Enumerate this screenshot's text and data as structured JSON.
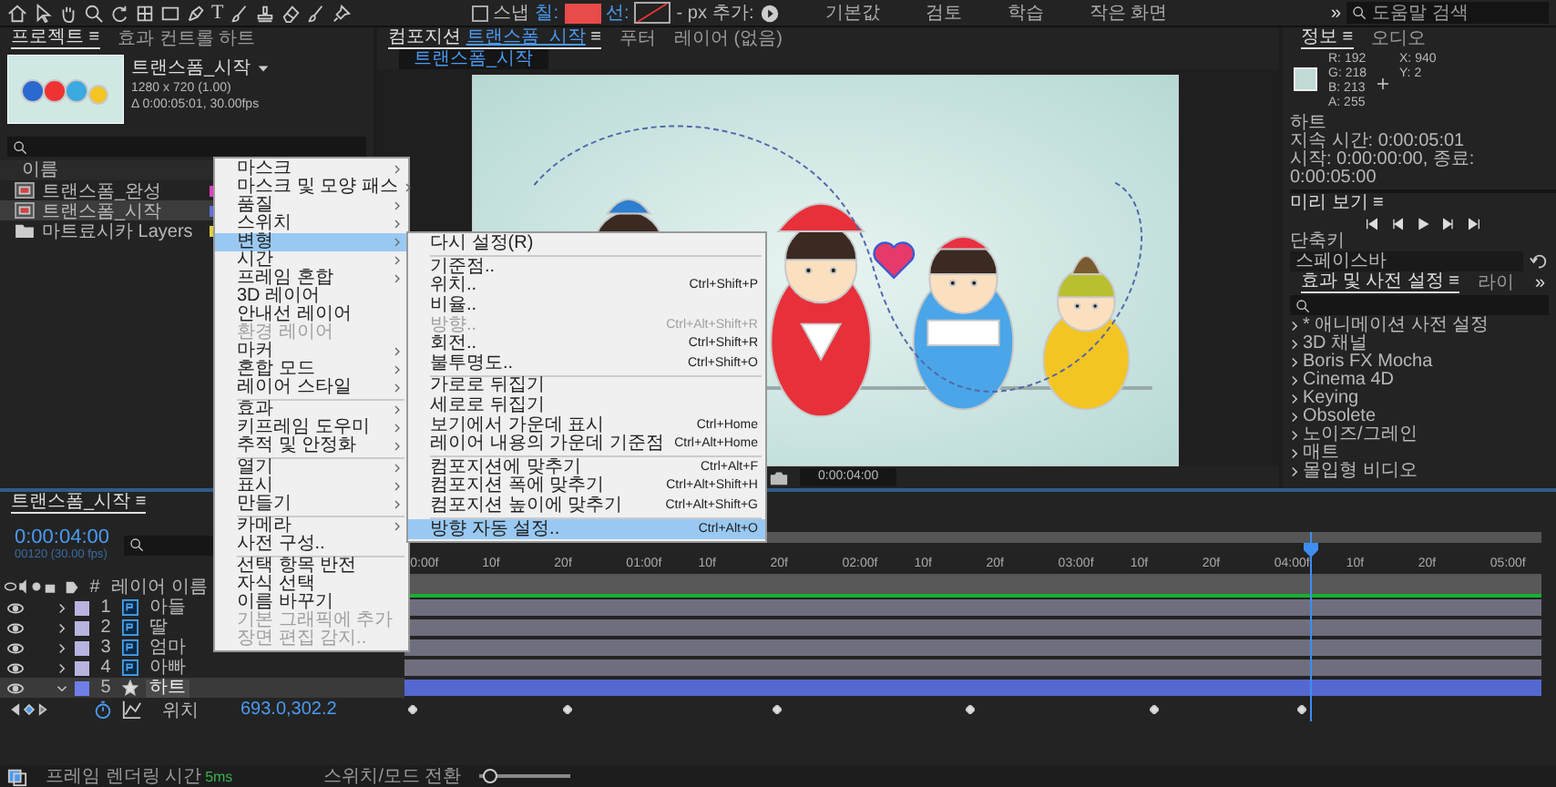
{
  "toolbar": {
    "type_tool": "T",
    "snap_checked": false,
    "snap": "스냅",
    "fill_label": "칠:",
    "stroke_label": "선:",
    "px": "- px",
    "add_label": "추가:",
    "workspaces": [
      "기본값",
      "검토",
      "학습",
      "작은 화면"
    ],
    "more": "»",
    "search_placeholder": "도움말 검색"
  },
  "project_panel": {
    "tabs": [
      {
        "label": "프로젝트",
        "menu": "≡",
        "selected": true
      },
      {
        "label": "효과 컨트롤 하트",
        "selected": false
      }
    ],
    "comp_name": "트랜스폼_시작",
    "comp_size": "1280 x 720 (1.00)",
    "comp_duration": "Δ 0:00:05:01, 30.00fps",
    "column": "이름",
    "items": [
      {
        "name": "트랜스폼_완성",
        "kind": "comp",
        "color": "#e040c0",
        "selected": false
      },
      {
        "name": "트랜스폼_시작",
        "kind": "comp",
        "color": "#6070e0",
        "selected": true
      },
      {
        "name": "마트료시카 Layers",
        "kind": "folder",
        "color": "#e0d040",
        "selected": false
      }
    ]
  },
  "composition_panel": {
    "tabs": [
      {
        "prefix": "컴포지션",
        "label": "트랜스폼_시작",
        "menu": "≡",
        "selected": true
      },
      {
        "label": "푸터",
        "selected": false
      },
      {
        "label": "레이어 (없음)",
        "selected": false
      }
    ],
    "comp_tab": "트랜스폼_시작",
    "current_time": "0:00:04:00"
  },
  "info_panel": {
    "tabs": [
      {
        "label": "정보",
        "menu": "≡",
        "selected": true
      },
      {
        "label": "오디오",
        "selected": false
      }
    ],
    "channels": [
      {
        "label": "R:",
        "value": "192"
      },
      {
        "label": "G:",
        "value": "218"
      },
      {
        "label": "B:",
        "value": "213"
      },
      {
        "label": "A:",
        "value": "255"
      }
    ],
    "coords": [
      {
        "label": "X:",
        "value": "940"
      },
      {
        "label": "Y:",
        "value": "2"
      }
    ],
    "lines": [
      "하트",
      "지속 시간: 0:00:05:01",
      "시작: 0:00:00:00, 종료: 0:00:05:00"
    ]
  },
  "preview_panel": {
    "title": "미리 보기",
    "menu": "≡",
    "shortcut_label": "단축키",
    "shortcut": "스페이스바"
  },
  "effects_panel": {
    "tabs": [
      {
        "label": "효과 및 사전 설정",
        "menu": "≡",
        "selected": true
      },
      {
        "label": "라이",
        "selected": false
      }
    ],
    "more": "»",
    "items": [
      "* 애니메이션 사전 설정",
      "3D 채널",
      "Boris FX Mocha",
      "Cinema 4D",
      "Keying",
      "Obsolete",
      "노이즈/그레인",
      "매트",
      "몰입형 비디오"
    ]
  },
  "timeline": {
    "tab": "트랜스폼_시작",
    "menu": "≡",
    "time": "0:00:04:00",
    "frames": "00120 (30.00 fps)",
    "index_header": "#",
    "column": "레이어 이름",
    "layers": [
      {
        "index": "1",
        "name": "아들",
        "kind": "file",
        "color": "#b8b4e0",
        "selected": false,
        "expanded": false
      },
      {
        "index": "2",
        "name": "딸",
        "kind": "file",
        "color": "#b8b4e0",
        "selected": false,
        "expanded": false
      },
      {
        "index": "3",
        "name": "엄마",
        "kind": "file",
        "color": "#b8b4e0",
        "selected": false,
        "expanded": false
      },
      {
        "index": "4",
        "name": "아빠",
        "kind": "file",
        "color": "#b8b4e0",
        "selected": false,
        "expanded": false
      },
      {
        "index": "5",
        "name": "하트",
        "kind": "shape",
        "color": "#6f7fe8",
        "selected": true,
        "expanded": true
      }
    ],
    "property": {
      "name": "위치",
      "value": "693.0,302.2"
    },
    "ruler": [
      "0:00f",
      "10f",
      "20f",
      "01:00f",
      "10f",
      "20f",
      "02:00f",
      "10f",
      "20f",
      "03:00f",
      "10f",
      "20f",
      "04:00f",
      "10f",
      "20f",
      "05:00f"
    ]
  },
  "status_bar": {
    "render_label": "프레임 렌더링 시간",
    "render_value": "5ms",
    "toggle": "스위치/모드 전환",
    "zoom_slider": {
      "level": 0.12
    }
  },
  "context_menu": {
    "groups": [
      [
        {
          "label": "마스크",
          "submenu": true,
          "disabled": false,
          "selected": false
        },
        {
          "label": "마스크 및 모양 패스",
          "submenu": true,
          "disabled": false,
          "selected": false
        },
        {
          "label": "품질",
          "submenu": true,
          "disabled": false,
          "selected": false
        },
        {
          "label": "스위치",
          "submenu": true,
          "disabled": false,
          "selected": false
        },
        {
          "label": "변형",
          "submenu": true,
          "disabled": false,
          "selected": true
        },
        {
          "label": "시간",
          "submenu": true,
          "disabled": false,
          "selected": false
        },
        {
          "label": "프레임 혼합",
          "submenu": true,
          "disabled": false,
          "selected": false
        },
        {
          "label": "3D 레이어",
          "submenu": false,
          "disabled": false,
          "selected": false
        },
        {
          "label": "안내선 레이어",
          "submenu": false,
          "disabled": false,
          "selected": false
        },
        {
          "label": "환경 레이어",
          "submenu": false,
          "disabled": true,
          "selected": false
        },
        {
          "label": "마커",
          "submenu": true,
          "disabled": false,
          "selected": false
        },
        {
          "label": "혼합 모드",
          "submenu": true,
          "disabled": false,
          "selected": false
        },
        {
          "label": "레이어 스타일",
          "submenu": true,
          "disabled": false,
          "selected": false
        }
      ],
      [
        {
          "label": "효과",
          "submenu": true,
          "disabled": false,
          "selected": false
        },
        {
          "label": "키프레임 도우미",
          "submenu": true,
          "disabled": false,
          "selected": false
        },
        {
          "label": "추적 및 안정화",
          "submenu": true,
          "disabled": false,
          "selected": false
        }
      ],
      [
        {
          "label": "열기",
          "submenu": true,
          "disabled": false,
          "selected": false
        },
        {
          "label": "표시",
          "submenu": true,
          "disabled": false,
          "selected": false
        },
        {
          "label": "만들기",
          "submenu": true,
          "disabled": false,
          "selected": false
        }
      ],
      [
        {
          "label": "카메라",
          "submenu": true,
          "disabled": false,
          "selected": false
        },
        {
          "label": "사전 구성..",
          "submenu": false,
          "disabled": false,
          "selected": false
        }
      ],
      [
        {
          "label": "선택 항목 반전",
          "submenu": false,
          "disabled": false,
          "selected": false
        },
        {
          "label": "자식 선택",
          "submenu": false,
          "disabled": false,
          "selected": false
        },
        {
          "label": "이름 바꾸기",
          "submenu": false,
          "disabled": false,
          "selected": false
        },
        {
          "label": "기본 그래픽에 추가",
          "submenu": false,
          "disabled": true,
          "selected": false
        },
        {
          "label": "장면 편집 감지..",
          "submenu": false,
          "disabled": true,
          "selected": false
        }
      ]
    ]
  },
  "submenu": {
    "groups": [
      [
        {
          "label": "다시 설정(R)",
          "disabled": false,
          "selected": false
        }
      ],
      [
        {
          "label": "기준점..",
          "disabled": false,
          "selected": false
        },
        {
          "label": "위치..",
          "shortcut": "Ctrl+Shift+P",
          "disabled": false,
          "selected": false
        },
        {
          "label": "비율..",
          "disabled": false,
          "selected": false
        },
        {
          "label": "방향..",
          "shortcut": "Ctrl+Alt+Shift+R",
          "disabled": true,
          "selected": false
        },
        {
          "label": "회전..",
          "shortcut": "Ctrl+Shift+R",
          "disabled": false,
          "selected": false
        },
        {
          "label": "불투명도..",
          "shortcut": "Ctrl+Shift+O",
          "disabled": false,
          "selected": false
        }
      ],
      [
        {
          "label": "가로로 뒤집기",
          "disabled": false,
          "selected": false
        },
        {
          "label": "세로로 뒤집기",
          "disabled": false,
          "selected": false
        },
        {
          "label": "보기에서 가운데 표시",
          "shortcut": "Ctrl+Home",
          "disabled": false,
          "selected": false
        },
        {
          "label": "레이어 내용의 가운데 기준점",
          "shortcut": "Ctrl+Alt+Home",
          "disabled": false,
          "selected": false
        }
      ],
      [
        {
          "label": "컴포지션에 맞추기",
          "shortcut": "Ctrl+Alt+F",
          "disabled": false,
          "selected": false
        },
        {
          "label": "컴포지션 폭에 맞추기",
          "shortcut": "Ctrl+Alt+Shift+H",
          "disabled": false,
          "selected": false
        },
        {
          "label": "컴포지션 높이에 맞추기",
          "shortcut": "Ctrl+Alt+Shift+G",
          "disabled": false,
          "selected": false
        }
      ],
      [
        {
          "label": "방향 자동 설정..",
          "shortcut": "Ctrl+Alt+O",
          "disabled": false,
          "selected": true
        }
      ]
    ]
  }
}
